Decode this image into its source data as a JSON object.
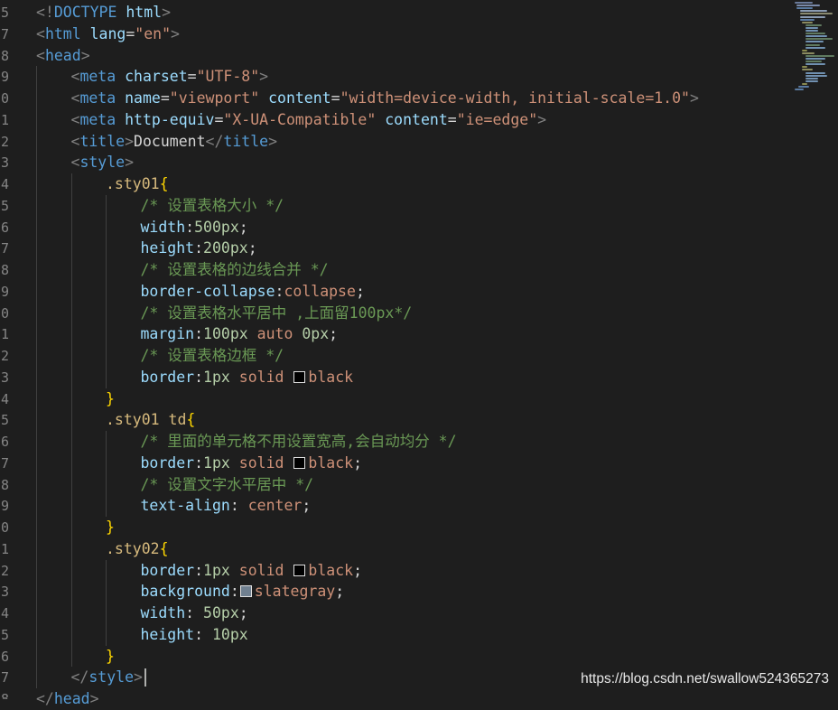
{
  "editor": {
    "line_numbers": [
      "5",
      "7",
      "8",
      "9",
      "0",
      "1",
      "2",
      "3",
      "4",
      "5",
      "6",
      "7",
      "8",
      "9",
      "0",
      "1",
      "2",
      "3",
      "4",
      "5",
      "6",
      "7",
      "8",
      "9",
      "0",
      "1",
      "2",
      "3",
      "4",
      "5",
      "6",
      "7",
      "8"
    ],
    "lines": [
      [
        {
          "t": "<!",
          "c": "punc"
        },
        {
          "t": "DOCTYPE",
          "c": "tag"
        },
        {
          "t": " html",
          "c": "attr"
        },
        {
          "t": ">",
          "c": "punc"
        }
      ],
      [
        {
          "t": "<",
          "c": "punc"
        },
        {
          "t": "html",
          "c": "tag"
        },
        {
          "t": " lang",
          "c": "attr"
        },
        {
          "t": "=",
          "c": "text"
        },
        {
          "t": "\"en\"",
          "c": "str"
        },
        {
          "t": ">",
          "c": "punc"
        }
      ],
      [
        {
          "t": "<",
          "c": "punc"
        },
        {
          "t": "head",
          "c": "tag"
        },
        {
          "t": ">",
          "c": "punc"
        }
      ],
      [
        {
          "t": "<",
          "c": "punc"
        },
        {
          "t": "meta",
          "c": "tag"
        },
        {
          "t": " charset",
          "c": "attr"
        },
        {
          "t": "=",
          "c": "text"
        },
        {
          "t": "\"UTF-8\"",
          "c": "str"
        },
        {
          "t": ">",
          "c": "punc"
        }
      ],
      [
        {
          "t": "<",
          "c": "punc"
        },
        {
          "t": "meta",
          "c": "tag"
        },
        {
          "t": " name",
          "c": "attr"
        },
        {
          "t": "=",
          "c": "text"
        },
        {
          "t": "\"viewport\"",
          "c": "str"
        },
        {
          "t": " content",
          "c": "attr"
        },
        {
          "t": "=",
          "c": "text"
        },
        {
          "t": "\"width=device-width, initial-scale=1.0\"",
          "c": "str"
        },
        {
          "t": ">",
          "c": "punc"
        }
      ],
      [
        {
          "t": "<",
          "c": "punc"
        },
        {
          "t": "meta",
          "c": "tag"
        },
        {
          "t": " http-equiv",
          "c": "attr"
        },
        {
          "t": "=",
          "c": "text"
        },
        {
          "t": "\"X-UA-Compatible\"",
          "c": "str"
        },
        {
          "t": " content",
          "c": "attr"
        },
        {
          "t": "=",
          "c": "text"
        },
        {
          "t": "\"ie=edge\"",
          "c": "str"
        },
        {
          "t": ">",
          "c": "punc"
        }
      ],
      [
        {
          "t": "<",
          "c": "punc"
        },
        {
          "t": "title",
          "c": "tag"
        },
        {
          "t": ">",
          "c": "punc"
        },
        {
          "t": "Document",
          "c": "text"
        },
        {
          "t": "</",
          "c": "punc"
        },
        {
          "t": "title",
          "c": "tag"
        },
        {
          "t": ">",
          "c": "punc"
        }
      ],
      [
        {
          "t": "<",
          "c": "punc"
        },
        {
          "t": "style",
          "c": "tag"
        },
        {
          "t": ">",
          "c": "punc"
        }
      ],
      [
        {
          "t": ".sty01",
          "c": "sel"
        },
        {
          "t": "{",
          "c": "brace"
        }
      ],
      [
        {
          "t": "/* 设置表格大小 */",
          "c": "comment"
        }
      ],
      [
        {
          "t": "width",
          "c": "prop"
        },
        {
          "t": ":",
          "c": "text"
        },
        {
          "t": "500px",
          "c": "num"
        },
        {
          "t": ";",
          "c": "text"
        }
      ],
      [
        {
          "t": "height",
          "c": "prop"
        },
        {
          "t": ":",
          "c": "text"
        },
        {
          "t": "200px",
          "c": "num"
        },
        {
          "t": ";",
          "c": "text"
        }
      ],
      [
        {
          "t": "/* 设置表格的边线合并 */",
          "c": "comment"
        }
      ],
      [
        {
          "t": "border-collapse",
          "c": "prop"
        },
        {
          "t": ":",
          "c": "text"
        },
        {
          "t": "collapse",
          "c": "val"
        },
        {
          "t": ";",
          "c": "text"
        }
      ],
      [
        {
          "t": "/* 设置表格水平居中 ,上面留100px*/",
          "c": "comment"
        }
      ],
      [
        {
          "t": "margin",
          "c": "prop"
        },
        {
          "t": ":",
          "c": "text"
        },
        {
          "t": "100px",
          "c": "num"
        },
        {
          "t": " auto ",
          "c": "val"
        },
        {
          "t": "0px",
          "c": "num"
        },
        {
          "t": ";",
          "c": "text"
        }
      ],
      [
        {
          "t": "/* 设置表格边框 */",
          "c": "comment"
        }
      ],
      [
        {
          "t": "border",
          "c": "prop"
        },
        {
          "t": ":",
          "c": "text"
        },
        {
          "t": "1px",
          "c": "num"
        },
        {
          "t": " solid ",
          "c": "val"
        },
        {
          "t": "",
          "c": "swatch",
          "color": "#000000"
        },
        {
          "t": "black",
          "c": "val"
        }
      ],
      [
        {
          "t": "}",
          "c": "brace"
        }
      ],
      [
        {
          "t": ".sty01 ",
          "c": "sel"
        },
        {
          "t": "td",
          "c": "sel"
        },
        {
          "t": "{",
          "c": "brace"
        }
      ],
      [
        {
          "t": "/* 里面的单元格不用设置宽高,会自动均分 */",
          "c": "comment"
        }
      ],
      [
        {
          "t": "border",
          "c": "prop"
        },
        {
          "t": ":",
          "c": "text"
        },
        {
          "t": "1px",
          "c": "num"
        },
        {
          "t": " solid ",
          "c": "val"
        },
        {
          "t": "",
          "c": "swatch",
          "color": "#000000"
        },
        {
          "t": "black",
          "c": "val"
        },
        {
          "t": ";",
          "c": "text"
        }
      ],
      [
        {
          "t": "/* 设置文字水平居中 */",
          "c": "comment"
        }
      ],
      [
        {
          "t": "text-align",
          "c": "prop"
        },
        {
          "t": ": ",
          "c": "text"
        },
        {
          "t": "center",
          "c": "val"
        },
        {
          "t": ";",
          "c": "text"
        }
      ],
      [
        {
          "t": "}",
          "c": "brace"
        }
      ],
      [
        {
          "t": ".sty02",
          "c": "sel"
        },
        {
          "t": "{",
          "c": "brace"
        }
      ],
      [
        {
          "t": "border",
          "c": "prop"
        },
        {
          "t": ":",
          "c": "text"
        },
        {
          "t": "1px",
          "c": "num"
        },
        {
          "t": " solid ",
          "c": "val"
        },
        {
          "t": "",
          "c": "swatch",
          "color": "#000000"
        },
        {
          "t": "black",
          "c": "val"
        },
        {
          "t": ";",
          "c": "text"
        }
      ],
      [
        {
          "t": "background",
          "c": "prop"
        },
        {
          "t": ":",
          "c": "text"
        },
        {
          "t": "",
          "c": "swatch",
          "color": "#708090"
        },
        {
          "t": "slategray",
          "c": "val"
        },
        {
          "t": ";",
          "c": "text"
        }
      ],
      [
        {
          "t": "width",
          "c": "prop"
        },
        {
          "t": ": ",
          "c": "text"
        },
        {
          "t": "50px",
          "c": "num"
        },
        {
          "t": ";",
          "c": "text"
        }
      ],
      [
        {
          "t": "height",
          "c": "prop"
        },
        {
          "t": ": ",
          "c": "text"
        },
        {
          "t": "10px",
          "c": "num"
        }
      ],
      [
        {
          "t": "}",
          "c": "brace"
        }
      ],
      [
        {
          "t": "</",
          "c": "punc"
        },
        {
          "t": "style",
          "c": "tag"
        },
        {
          "t": ">",
          "c": "punc"
        }
      ],
      [
        {
          "t": "</",
          "c": "punc"
        },
        {
          "t": "head",
          "c": "tag"
        },
        {
          "t": ">",
          "c": "punc"
        }
      ]
    ]
  },
  "watermark": "https://blog.csdn.net/swallow524365273",
  "colors": {
    "background": "#1e1e1e",
    "line_number": "#858585",
    "tag": "#569cd6",
    "attribute": "#9cdcfe",
    "string": "#ce9178",
    "selector": "#d7ba7d",
    "brace": "#ffd700",
    "comment": "#6a9955",
    "number": "#b5cea8",
    "swatch_black": "#000000",
    "swatch_slategray": "#708090"
  }
}
